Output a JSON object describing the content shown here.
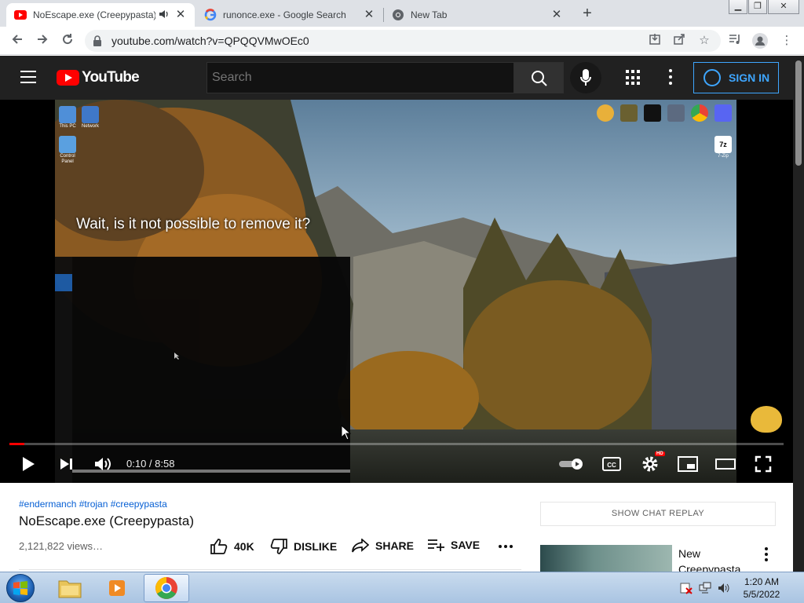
{
  "browser": {
    "tabs": [
      {
        "title": "NoEscape.exe (Creepypasta)",
        "favicon": "youtube-icon",
        "active": true,
        "audio": true
      },
      {
        "title": "runonce.exe - Google Search",
        "favicon": "google-icon",
        "active": false
      },
      {
        "title": "New Tab",
        "favicon": "chrome-icon",
        "active": false
      }
    ],
    "url": "youtube.com/watch?v=QPQQVMwOEc0"
  },
  "youtube": {
    "logo_text": "YouTube",
    "search_placeholder": "Search",
    "sign_in": "SIGN IN"
  },
  "player": {
    "caption": "Wait, is it not possible to remove it?",
    "current_time": "0:10",
    "duration": "8:58",
    "time_display": "0:10 / 8:58",
    "progress_fraction": 0.019,
    "hd_badge": "HD",
    "desktop_icons": {
      "this_pc": "This PC",
      "network": "Network",
      "control_panel": "Control Panel",
      "app_7z": "7-Zip"
    }
  },
  "video": {
    "hashtags": "#endermanch #trojan #creepypasta",
    "title": "NoEscape.exe (Creepypasta)",
    "views": "2,121,822 views…",
    "likes": "40K",
    "dislike": "DISLIKE",
    "share": "SHARE",
    "save": "SAVE"
  },
  "sidebar": {
    "chat_replay": "SHOW CHAT REPLAY",
    "recommended_title": "New Creepypasta…"
  },
  "taskbar": {
    "time": "1:20 AM",
    "date": "5/5/2022"
  },
  "colors": {
    "youtube_red": "#ff0000",
    "signin_blue": "#3ea6ff",
    "link_blue": "#065fd4",
    "header_dark": "#212121"
  }
}
